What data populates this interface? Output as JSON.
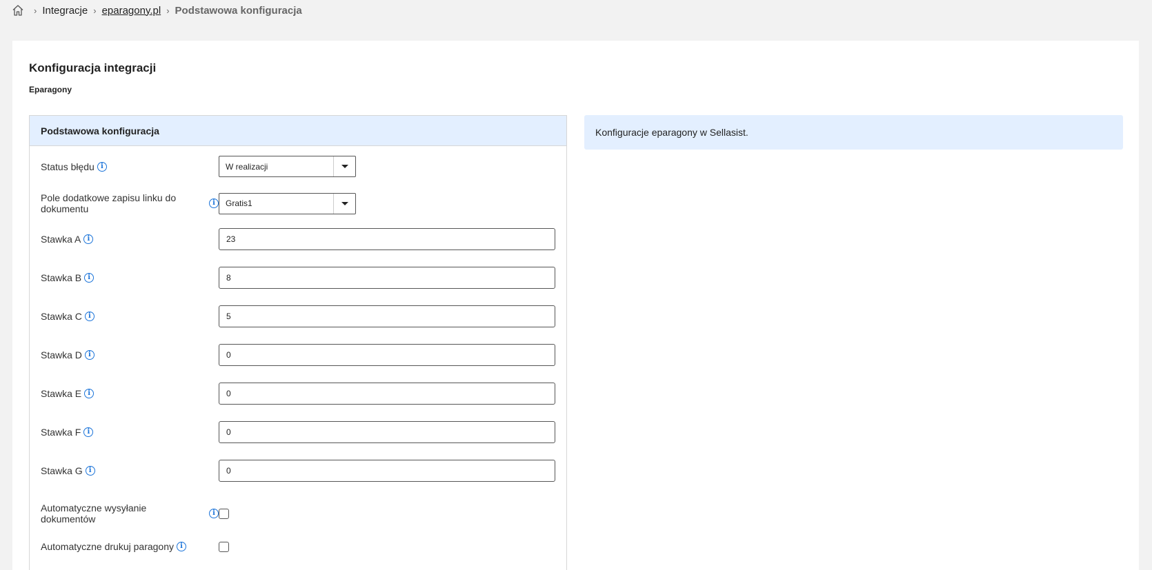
{
  "breadcrumb": {
    "home_icon": "home-icon",
    "items": [
      "Integracje",
      "eparagony.pl",
      "Podstawowa konfiguracja"
    ]
  },
  "card": {
    "title": "Konfiguracja integracji",
    "subtitle": "Eparagony"
  },
  "panel": {
    "header": "Podstawowa konfiguracja",
    "fields": {
      "error_status": {
        "label": "Status błędu",
        "value": "W realizacji"
      },
      "link_field": {
        "label": "Pole dodatkowe zapisu linku do dokumentu",
        "value": "Gratis1"
      },
      "rate_a": {
        "label": "Stawka A",
        "value": "23"
      },
      "rate_b": {
        "label": "Stawka B",
        "value": "8"
      },
      "rate_c": {
        "label": "Stawka C",
        "value": "5"
      },
      "rate_d": {
        "label": "Stawka D",
        "value": "0"
      },
      "rate_e": {
        "label": "Stawka E",
        "value": "0"
      },
      "rate_f": {
        "label": "Stawka F",
        "value": "0"
      },
      "rate_g": {
        "label": "Stawka G",
        "value": "0"
      },
      "auto_send": {
        "label": "Automatyczne wysyłanie dokumentów",
        "checked": false
      },
      "auto_print": {
        "label": "Automatyczne drukuj paragony",
        "checked": false
      }
    }
  },
  "note": {
    "text": "Konfiguracje eparagony w Sellasist."
  },
  "colors": {
    "page_bg": "#f2f2f2",
    "panel_header_bg": "#e3efff",
    "info_icon": "#1a73d9"
  }
}
